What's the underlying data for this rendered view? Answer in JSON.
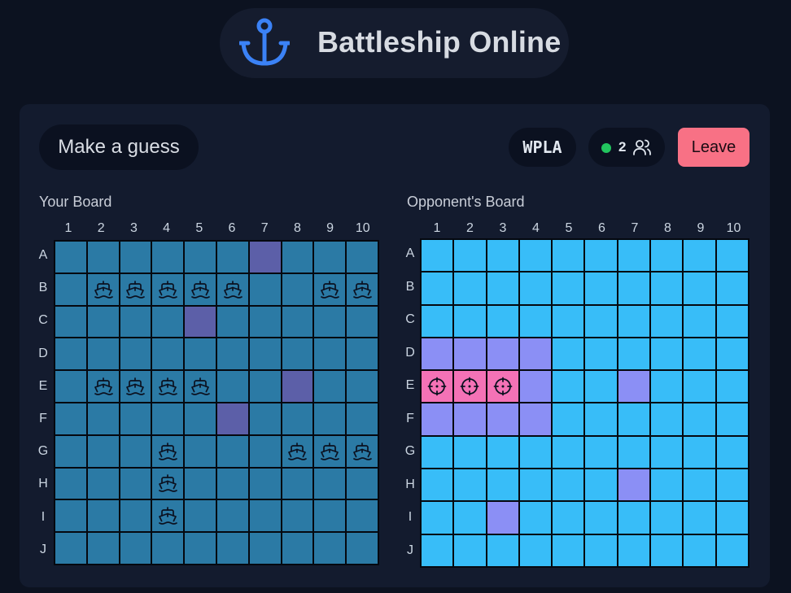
{
  "header": {
    "title": "Battleship Online",
    "logo_icon": "anchor-icon"
  },
  "toolbar": {
    "status_label": "Make a guess",
    "game_code": "WPLA",
    "player_count": "2",
    "players_icon": "users-icon",
    "leave_label": "Leave"
  },
  "columns": [
    "1",
    "2",
    "3",
    "4",
    "5",
    "6",
    "7",
    "8",
    "9",
    "10"
  ],
  "rows": [
    "A",
    "B",
    "C",
    "D",
    "E",
    "F",
    "G",
    "H",
    "I",
    "J"
  ],
  "colors": {
    "your_water": "#2b7aa5",
    "your_miss": "#5c5fa8",
    "opp_water": "#38bdf8",
    "opp_miss": "#8b8ff5",
    "opp_hit": "#f472b6",
    "accent": "#f87185",
    "online": "#22c55e",
    "anchor": "#3b82f6"
  },
  "your_board": {
    "title": "Your Board",
    "grid": [
      "~~~~~~o~~~",
      "~SSSSS~~SS",
      "~~~~o~~~~~",
      "~~~~~~~~~~",
      "~SSSS~~o~~",
      "~~~~~o~~~~",
      "~~~S~~~SSS",
      "~~~S~~~~~~",
      "~~~S~~~~~~",
      "~~~~~~~~~~"
    ]
  },
  "opponent_board": {
    "title": "Opponent's Board",
    "grid": [
      "~~~~~~~~~~",
      "~~~~~~~~~~",
      "~~~~~~~~~~",
      "oooo~~~~~~",
      "XXXo~~o~~~",
      "oooo~~~~~~",
      "~~~~~~~~~~",
      "~~~~~~o~~~",
      "~~o~~~~~~~",
      "~~~~~~~~~~"
    ]
  }
}
